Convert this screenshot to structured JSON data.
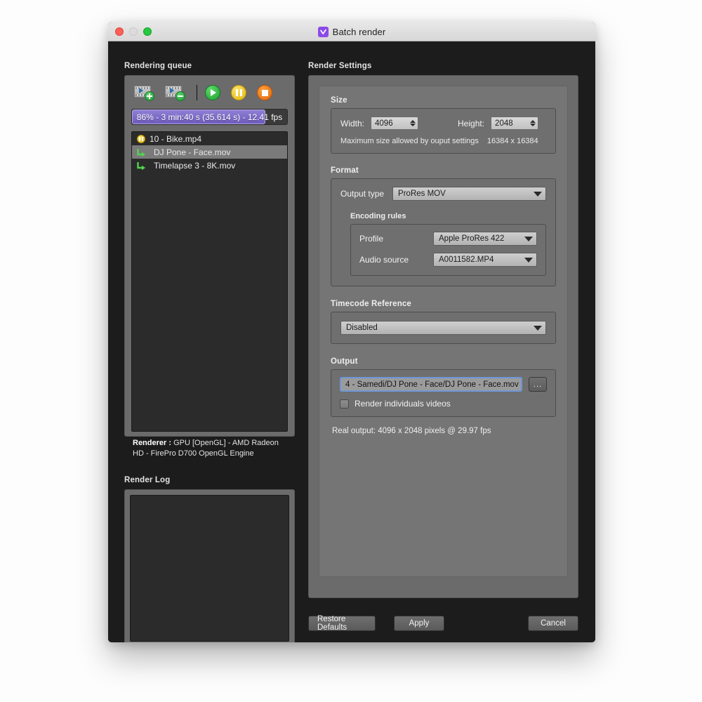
{
  "window": {
    "title": "Batch render",
    "app_icon": "checkmark-box-icon",
    "traffic_lights": [
      "close",
      "minimize",
      "zoom"
    ]
  },
  "left": {
    "queue_label": "Rendering queue",
    "toolbar": {
      "add_label": "add-clip",
      "remove_label": "remove-clip",
      "play_label": "play",
      "pause_label": "pause",
      "stop_label": "stop"
    },
    "progress": {
      "percent": 86,
      "text": "86% - 3 min:40 s (35.614 s) - 12.41 fps"
    },
    "queue_items": [
      {
        "icon": "pause",
        "label": "10 - Bike.mp4",
        "selected": false
      },
      {
        "icon": "arrow",
        "label": "DJ Pone - Face.mov",
        "selected": true
      },
      {
        "icon": "arrow",
        "label": "Timelapse 3 - 8K.mov",
        "selected": false
      }
    ],
    "renderer_prefix": "Renderer :",
    "renderer_value": " GPU [OpenGL] - AMD Radeon HD - FirePro D700 OpenGL Engine",
    "log_label": "Render Log",
    "log_content": ""
  },
  "right": {
    "settings_label": "Render Settings",
    "size": {
      "title": "Size",
      "width_label": "Width:",
      "width_value": "4096",
      "height_label": "Height:",
      "height_value": "2048",
      "max_note": "Maximum size allowed by ouput settings",
      "max_value": "16384 x 16384"
    },
    "format": {
      "title": "Format",
      "output_type_label": "Output type",
      "output_type_value": "ProRes MOV",
      "encoding_title": "Encoding rules",
      "profile_label": "Profile",
      "profile_value": "Apple ProRes 422",
      "audio_label": "Audio source",
      "audio_value": "A0011582.MP4"
    },
    "timecode": {
      "title": "Timecode Reference",
      "value": "Disabled"
    },
    "output": {
      "title": "Output",
      "path_value": "4 - Samedi/DJ Pone - Face/DJ Pone - Face.mov",
      "browse_label": "...",
      "checkbox_label": "Render individuals videos",
      "checkbox_checked": false,
      "real_output": "Real output: 4096 x 2048 pixels @ 29.97 fps"
    },
    "buttons": {
      "restore": "Restore Defaults",
      "apply": "Apply",
      "cancel": "Cancel"
    }
  },
  "colors": {
    "window_bg": "#1c1c1c",
    "panel_bg": "#6b6b6b",
    "accent_purple": "#7a66c7",
    "focus_blue": "#6f97d8",
    "play_green": "#18a02f",
    "pause_yellow": "#e3b60d",
    "stop_orange": "#e56a0c"
  }
}
